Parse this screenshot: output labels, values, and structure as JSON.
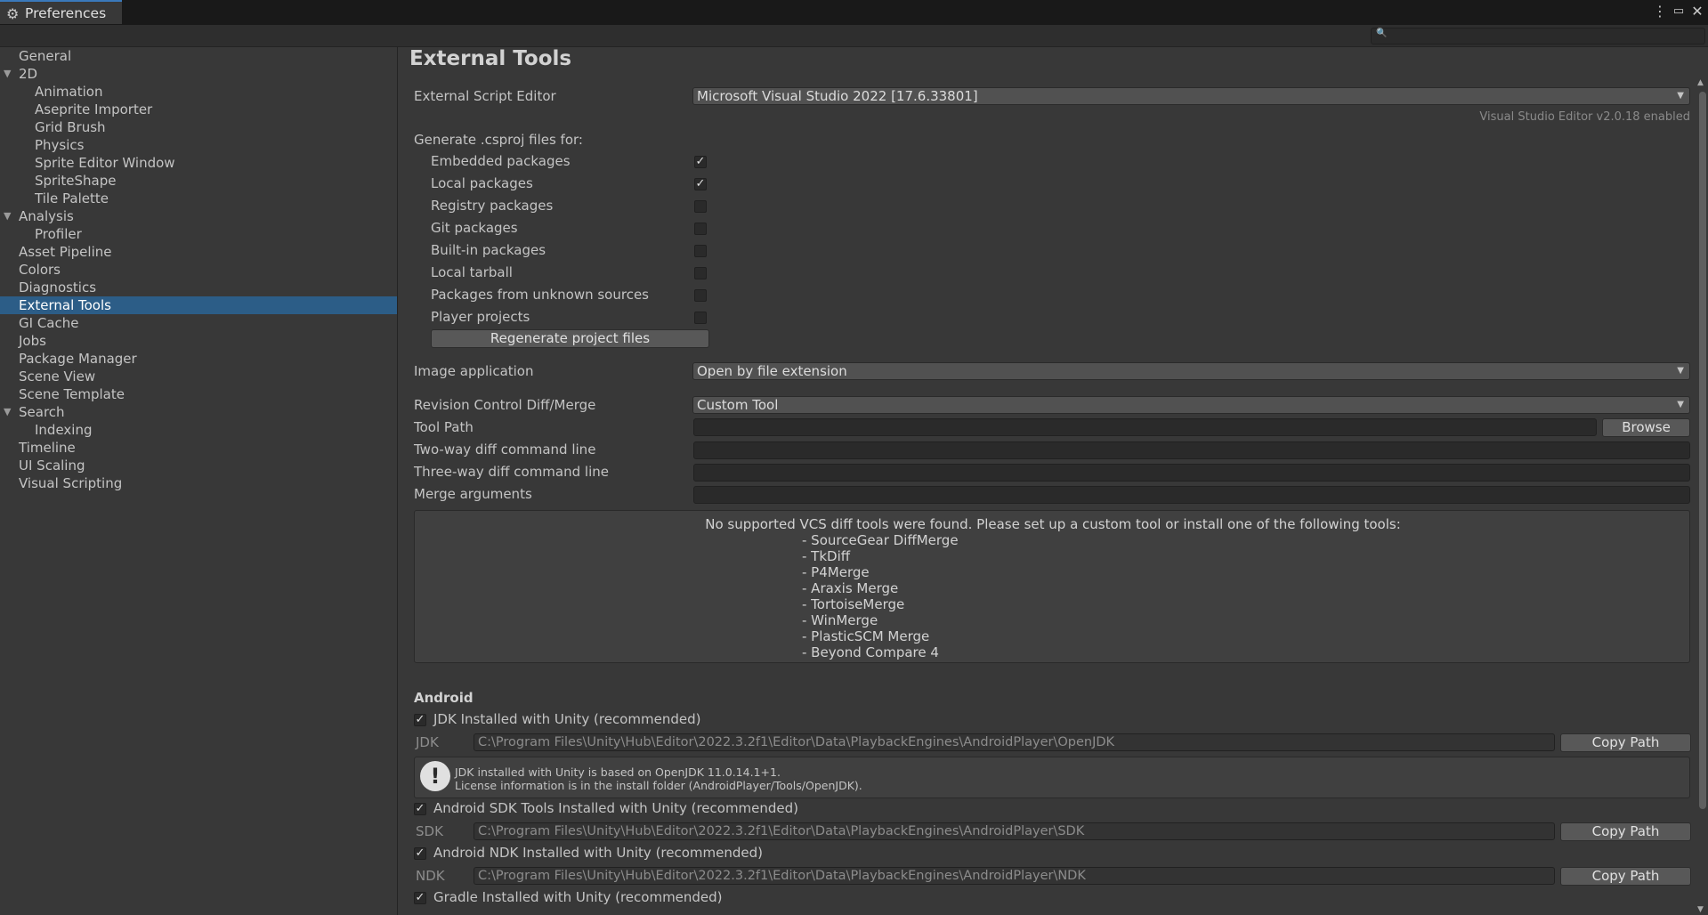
{
  "window": {
    "tab_title": "Preferences",
    "tab_icon": "gear-icon"
  },
  "search": {
    "placeholder": ""
  },
  "sidebar": {
    "items": [
      {
        "label": "General",
        "level": 0
      },
      {
        "label": "2D",
        "level": 0,
        "foldout": true
      },
      {
        "label": "Animation",
        "level": 1
      },
      {
        "label": "Aseprite Importer",
        "level": 1
      },
      {
        "label": "Grid Brush",
        "level": 1
      },
      {
        "label": "Physics",
        "level": 1
      },
      {
        "label": "Sprite Editor Window",
        "level": 1
      },
      {
        "label": "SpriteShape",
        "level": 1
      },
      {
        "label": "Tile Palette",
        "level": 1
      },
      {
        "label": "Analysis",
        "level": 0,
        "foldout": true
      },
      {
        "label": "Profiler",
        "level": 1
      },
      {
        "label": "Asset Pipeline",
        "level": 0
      },
      {
        "label": "Colors",
        "level": 0
      },
      {
        "label": "Diagnostics",
        "level": 0
      },
      {
        "label": "External Tools",
        "level": 0,
        "selected": true
      },
      {
        "label": "GI Cache",
        "level": 0
      },
      {
        "label": "Jobs",
        "level": 0
      },
      {
        "label": "Package Manager",
        "level": 0
      },
      {
        "label": "Scene View",
        "level": 0
      },
      {
        "label": "Scene Template",
        "level": 0
      },
      {
        "label": "Search",
        "level": 0,
        "foldout": true
      },
      {
        "label": "Indexing",
        "level": 1
      },
      {
        "label": "Timeline",
        "level": 0
      },
      {
        "label": "UI Scaling",
        "level": 0
      },
      {
        "label": "Visual Scripting",
        "level": 0
      }
    ]
  },
  "main": {
    "title": "External Tools",
    "script_editor": {
      "label": "External Script Editor",
      "value": "Microsoft Visual Studio 2022 [17.6.33801]",
      "note": "Visual Studio Editor v2.0.18 enabled"
    },
    "csproj": {
      "label": "Generate .csproj files for:",
      "options": [
        {
          "label": "Embedded packages",
          "checked": true
        },
        {
          "label": "Local packages",
          "checked": true
        },
        {
          "label": "Registry packages",
          "checked": false
        },
        {
          "label": "Git packages",
          "checked": false
        },
        {
          "label": "Built-in packages",
          "checked": false
        },
        {
          "label": "Local tarball",
          "checked": false
        },
        {
          "label": "Packages from unknown sources",
          "checked": false
        },
        {
          "label": "Player projects",
          "checked": false
        }
      ],
      "regenerate_label": "Regenerate project files"
    },
    "image_app": {
      "label": "Image application",
      "value": "Open by file extension"
    },
    "revision": {
      "label": "Revision Control Diff/Merge",
      "value": "Custom Tool"
    },
    "tool_path": {
      "label": "Tool Path",
      "browse_label": "Browse"
    },
    "two_way": {
      "label": "Two-way diff command line"
    },
    "three_way": {
      "label": "Three-way diff command line"
    },
    "merge_args": {
      "label": "Merge arguments"
    },
    "vcs_help": {
      "heading": "No supported VCS diff tools were found. Please set up a custom tool or install one of the following tools:",
      "tools": [
        "- SourceGear DiffMerge",
        "- TkDiff",
        "- P4Merge",
        "- Araxis Merge",
        "- TortoiseMerge",
        "- WinMerge",
        "- PlasticSCM Merge",
        "- Beyond Compare 4"
      ]
    },
    "android": {
      "heading": "Android",
      "jdk_toggle": "JDK Installed with Unity (recommended)",
      "jdk_label": "JDK",
      "jdk_path": "C:\\Program Files\\Unity\\Hub\\Editor\\2022.3.2f1\\Editor\\Data\\PlaybackEngines\\AndroidPlayer\\OpenJDK",
      "jdk_info_1": "JDK installed with Unity is based on OpenJDK 11.0.14.1+1.",
      "jdk_info_2": "License information is in the install folder (AndroidPlayer/Tools/OpenJDK).",
      "sdk_toggle": "Android SDK Tools Installed with Unity (recommended)",
      "sdk_label": "SDK",
      "sdk_path": "C:\\Program Files\\Unity\\Hub\\Editor\\2022.3.2f1\\Editor\\Data\\PlaybackEngines\\AndroidPlayer\\SDK",
      "ndk_toggle": "Android NDK Installed with Unity (recommended)",
      "ndk_label": "NDK",
      "ndk_path": "C:\\Program Files\\Unity\\Hub\\Editor\\2022.3.2f1\\Editor\\Data\\PlaybackEngines\\AndroidPlayer\\NDK",
      "gradle_toggle": "Gradle Installed with Unity (recommended)",
      "copy_path_label": "Copy Path"
    }
  }
}
